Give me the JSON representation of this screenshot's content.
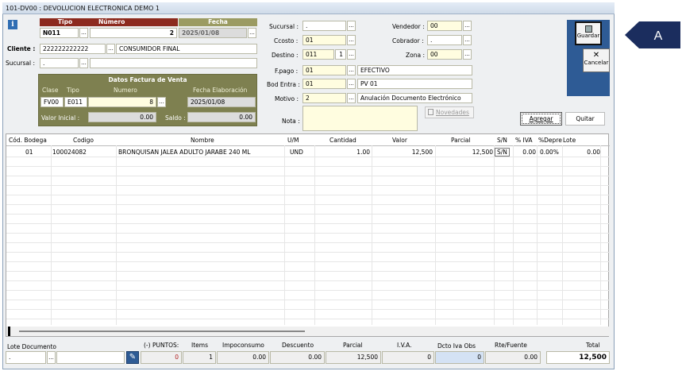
{
  "window": {
    "title": "101-DV00 : DEVOLUCION ELECTRONICA DEMO 1"
  },
  "header": {
    "tipo_label": "Tipo",
    "numero_label": "Número",
    "fecha_label": "Fecha",
    "tipo": "N011",
    "numero": "2",
    "fecha": "2025/01/08",
    "cliente_label": "Cliente :",
    "cliente_id": "222222222222",
    "cliente_nombre": "CONSUMIDOR FINAL",
    "sucursal_label": "Sucursal :",
    "sucursal": "."
  },
  "factura": {
    "title": "Datos Factura de Venta",
    "clase_label": "Clase",
    "tipo_label": "Tipo",
    "numero_label": "Numero",
    "fecha_label": "Fecha Elaboración",
    "clase": "FV00",
    "tipo": "E011",
    "numero": "8",
    "fecha": "2025/01/08",
    "valor_inicial_label": "Valor Inicial :",
    "valor_inicial": "0.00",
    "saldo_label": "Saldo :",
    "saldo": "0.00"
  },
  "center": {
    "sucursal_label": "Sucursal :",
    "sucursal": ".",
    "ccosto_label": "Ccosto :",
    "ccosto": "01",
    "destino_label": "Destino :",
    "destino": "011",
    "destino_num": "1",
    "fpago_label": "F.pago :",
    "fpago": "01",
    "fpago_desc": "EFECTIVO",
    "bod_label": "Bod Entra :",
    "bod": "01",
    "bod_desc": "PV 01",
    "motivo_label": "Motivo :",
    "motivo": "2",
    "motivo_desc": "Anulación Documento Electrónico",
    "nota_label": "Nota :",
    "nota": "",
    "vendedor_label": "Vendedor :",
    "vendedor": "00",
    "cobrador_label": "Cobrador :",
    "cobrador": ".",
    "zona_label": "Zona :",
    "zona": "00",
    "novedades_label": "Novedades",
    "agregar_label": "Agregar",
    "quitar_label": "Quitar"
  },
  "side": {
    "guardar_label": "Guardar",
    "cancelar_label": "Cancelar"
  },
  "callout": {
    "letter": "A"
  },
  "grid": {
    "columns": [
      "Cód. Bodega",
      "Codigo",
      "Nombre",
      "U/M",
      "Cantidad",
      "Valor",
      "Parcial",
      "S/N",
      "% IVA",
      "%Depre",
      "Lote"
    ],
    "rows": [
      {
        "bodega": "01",
        "codigo": "100024082",
        "nombre": "BRONQUISAN JALEA ADULTO JARABE 240 ML",
        "um": "UND",
        "cantidad": "1.00",
        "valor": "12,500",
        "parcial": "12,500",
        "sn": "S/N",
        "iva": "0.00",
        "depre": "0.00%",
        "lote": "0.00"
      }
    ]
  },
  "footer": {
    "lote_label": "Lote Documento",
    "lote": ".",
    "puntos_label": "(-) PUNTOS:",
    "puntos": "0",
    "items_label": "Items",
    "items": "1",
    "impoconsumo_label": "Impoconsumo",
    "impoconsumo": "0.00",
    "descuento_label": "Descuento",
    "descuento": "0.00",
    "parcial_label": "Parcial",
    "parcial": "12,500",
    "iva_label": "I.V.A.",
    "iva": "0",
    "dcto_label": "Dcto Iva Obs",
    "dcto": "0",
    "rte_label": "Rte/Fuente",
    "rte": "0.00",
    "total_label": "Total",
    "total": "12,500"
  }
}
